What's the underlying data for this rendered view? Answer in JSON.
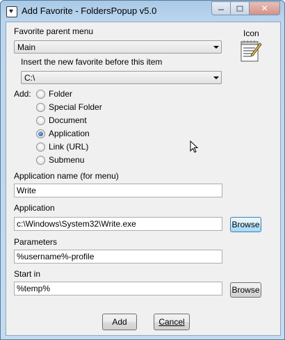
{
  "window": {
    "title": "Add Favorite - FoldersPopup v5.0",
    "icon": "heart-app-icon",
    "controls": {
      "minimize": "minimize-icon",
      "maximize": "maximize-icon",
      "close": "✕"
    }
  },
  "form": {
    "parent_menu_label": "Favorite parent menu",
    "parent_menu_value": "Main",
    "icon_label": "Icon",
    "icon_name": "notepad-write-icon",
    "insert_before_label": "Insert the new favorite before this item",
    "insert_before_value": "C:\\",
    "add_label": "Add:",
    "add_options": [
      {
        "label": "Folder",
        "checked": false
      },
      {
        "label": "Special Folder",
        "checked": false
      },
      {
        "label": "Document",
        "checked": false
      },
      {
        "label": "Application",
        "checked": true
      },
      {
        "label": "Link (URL)",
        "checked": false
      },
      {
        "label": "Submenu",
        "checked": false
      }
    ],
    "app_name_label": "Application name (for menu)",
    "app_name_value": "Write",
    "application_label": "Application",
    "application_value": "c:\\Windows\\System32\\Write.exe",
    "browse_label": "Browse",
    "parameters_label": "Parameters",
    "parameters_value": "%username%-profile",
    "start_in_label": "Start in",
    "start_in_value": "%temp%",
    "browse2_label": "Browse"
  },
  "buttons": {
    "add": "Add",
    "cancel": "Cancel"
  }
}
